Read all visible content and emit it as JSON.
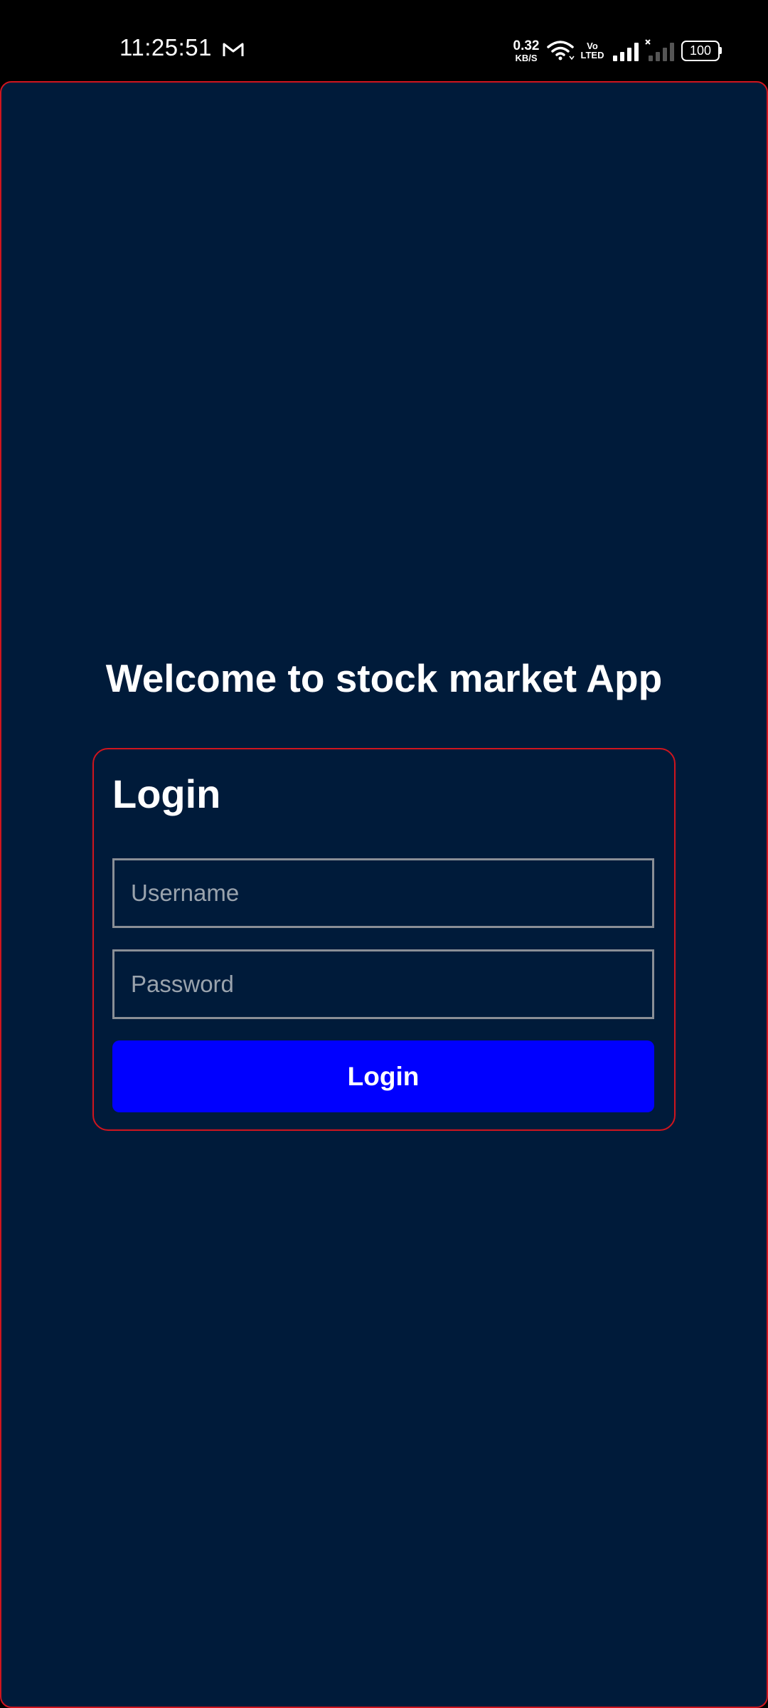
{
  "status_bar": {
    "time": "11:25:51",
    "net_speed_value": "0.32",
    "net_speed_unit": "KB/S",
    "volte_top": "Vo",
    "volte_bottom": "LTED",
    "battery": "100",
    "icons": [
      "gmail-icon",
      "wifi-icon",
      "volte-icon",
      "signal-icon",
      "signal-no-service-icon",
      "battery-icon"
    ]
  },
  "app": {
    "welcome_title": "Welcome to stock market App",
    "login_heading": "Login",
    "username_placeholder": "Username",
    "password_placeholder": "Password",
    "login_button_label": "Login",
    "colors": {
      "background": "#001b3a",
      "border_accent": "#d0151e",
      "button": "#0000ff",
      "text": "#ffffff"
    }
  }
}
